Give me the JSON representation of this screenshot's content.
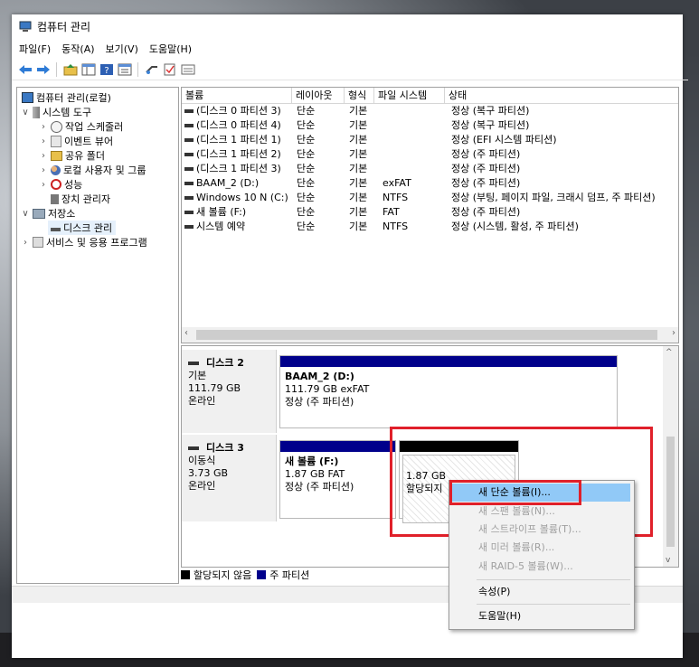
{
  "window": {
    "title": "컴퓨터 관리"
  },
  "menu": [
    "파일(F)",
    "동작(A)",
    "보기(V)",
    "도움말(H)"
  ],
  "toolbar_icons": [
    "back-arrow-icon",
    "forward-arrow-icon",
    "up-folder-icon",
    "console-tree-icon",
    "help-icon",
    "properties-icon",
    "connect-icon",
    "check-icon",
    "detail-view-icon"
  ],
  "tree": [
    {
      "label": "컴퓨터 관리(로컬)",
      "icon": "computer-management-icon"
    },
    {
      "label": "시스템 도구",
      "icon": "tools-icon"
    },
    {
      "label": "작업 스케줄러",
      "icon": "clock-icon"
    },
    {
      "label": "이벤트 뷰어",
      "icon": "event-viewer-icon"
    },
    {
      "label": "공유 폴더",
      "icon": "shared-folder-icon"
    },
    {
      "label": "로컬 사용자 및 그룹",
      "icon": "users-icon"
    },
    {
      "label": "성능",
      "icon": "performance-icon"
    },
    {
      "label": "장치 관리자",
      "icon": "device-manager-icon"
    },
    {
      "label": "저장소",
      "icon": "storage-icon"
    },
    {
      "label": "디스크 관리",
      "icon": "disk-icon"
    },
    {
      "label": "서비스 및 응용 프로그램",
      "icon": "services-icon"
    }
  ],
  "volume_list": {
    "headers": [
      "볼륨",
      "레이아웃",
      "형식",
      "파일 시스템",
      "상태"
    ],
    "rows": [
      [
        "(디스크 0 파티션 3)",
        "단순",
        "기본",
        "",
        "정상 (복구 파티션)"
      ],
      [
        "(디스크 0 파티션 4)",
        "단순",
        "기본",
        "",
        "정상 (복구 파티션)"
      ],
      [
        "(디스크 1 파티션 1)",
        "단순",
        "기본",
        "",
        "정상 (EFI 시스템 파티션)"
      ],
      [
        "(디스크 1 파티션 2)",
        "단순",
        "기본",
        "",
        "정상 (주 파티션)"
      ],
      [
        "(디스크 1 파티션 3)",
        "단순",
        "기본",
        "",
        "정상 (주 파티션)"
      ],
      [
        "BAAM_2 (D:)",
        "단순",
        "기본",
        "exFAT",
        "정상 (주 파티션)"
      ],
      [
        "Windows 10 N (C:)",
        "단순",
        "기본",
        "NTFS",
        "정상 (부팅, 페이지 파일, 크래시 덤프, 주 파티션)"
      ],
      [
        "새 볼륨 (F:)",
        "단순",
        "기본",
        "FAT",
        "정상 (주 파티션)"
      ],
      [
        "시스템 예약",
        "단순",
        "기본",
        "NTFS",
        "정상 (시스템, 활성, 주 파티션)"
      ]
    ]
  },
  "disks": {
    "disk2": {
      "name": "디스크 2",
      "type": "기본",
      "size": "111.79 GB",
      "status": "온라인",
      "partition": {
        "name": "BAAM_2  (D:)",
        "size": "111.79 GB exFAT",
        "status": "정상 (주 파티션)"
      }
    },
    "disk3": {
      "name": "디스크 3",
      "type": "이동식",
      "size": "3.73 GB",
      "status": "온라인",
      "partition": {
        "name": "새 볼륨  (F:)",
        "size": "1.87 GB FAT",
        "status": "정상 (주 파티션)"
      },
      "unallocated": {
        "size": "1.87 GB",
        "status": "할당되지"
      }
    }
  },
  "legend": {
    "unallocated": "할당되지 않음",
    "primary": "주 파티션"
  },
  "colors": {
    "primary": "#00008b",
    "unallocated": "#000000",
    "highlight": "#91c9f7",
    "redbox": "#e0202a"
  },
  "context_menu": {
    "new_simple": "새 단순 볼륨(I)...",
    "new_spanned": "새 스팬 볼륨(N)...",
    "new_striped": "새 스트라이프 볼륨(T)...",
    "new_mirror": "새 미러 볼륨(R)...",
    "new_raid5": "새 RAID-5 볼륨(W)...",
    "properties": "속성(P)",
    "help": "도움말(H)"
  }
}
